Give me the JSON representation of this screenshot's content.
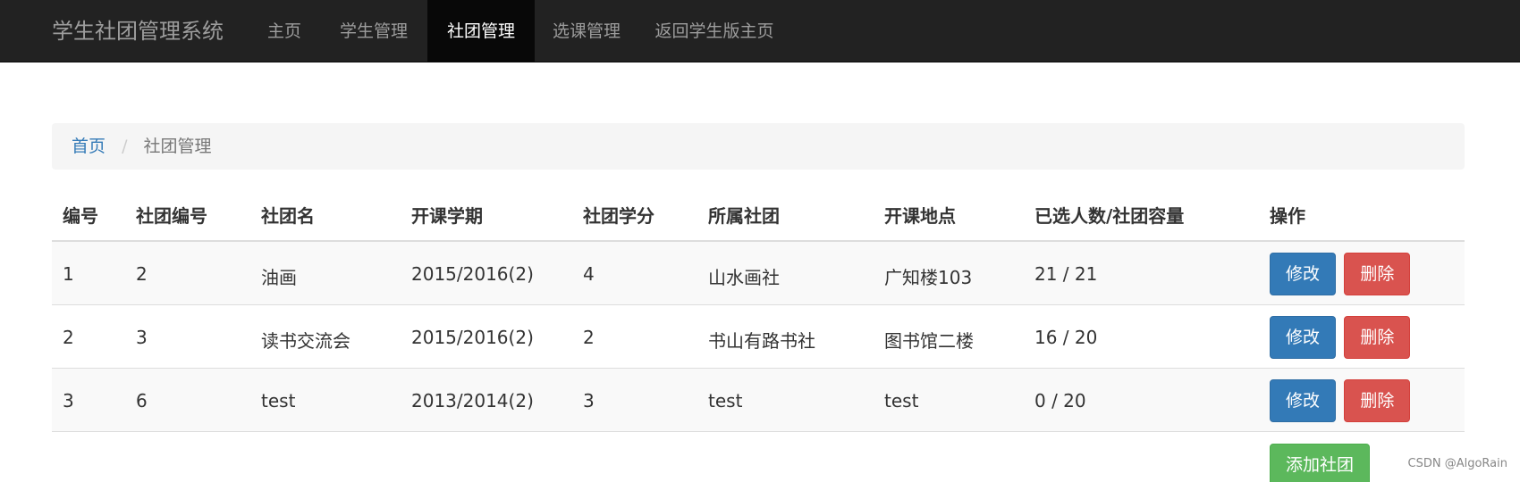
{
  "navbar": {
    "brand": "学生社团管理系统",
    "items": [
      {
        "label": "主页"
      },
      {
        "label": "学生管理"
      },
      {
        "label": "社团管理"
      },
      {
        "label": "选课管理"
      },
      {
        "label": "返回学生版主页"
      }
    ],
    "active_index": 2
  },
  "breadcrumb": {
    "home": "首页",
    "separator": "/",
    "current": "社团管理"
  },
  "table": {
    "headers": [
      "编号",
      "社团编号",
      "社团名",
      "开课学期",
      "社团学分",
      "所属社团",
      "开课地点",
      "已选人数/社团容量",
      "操作"
    ],
    "rows": [
      [
        "1",
        "2",
        "油画",
        "2015/2016(2)",
        "4",
        "山水画社",
        "广知楼103",
        "21 / 21"
      ],
      [
        "2",
        "3",
        "读书交流会",
        "2015/2016(2)",
        "2",
        "书山有路书社",
        "图书馆二楼",
        "16 / 20"
      ],
      [
        "3",
        "6",
        "test",
        "2013/2014(2)",
        "3",
        "test",
        "test",
        "0 / 20"
      ]
    ],
    "edit_label": "修改",
    "delete_label": "删除"
  },
  "add_button": {
    "label": "添加社团"
  },
  "watermark": "CSDN @AlgoRain",
  "colors": {
    "navbar_bg": "#222222",
    "nav_active_bg": "#080808",
    "link": "#337ab7",
    "btn_primary": "#337ab7",
    "btn_danger": "#d9534f",
    "btn_success": "#5cb85c"
  }
}
